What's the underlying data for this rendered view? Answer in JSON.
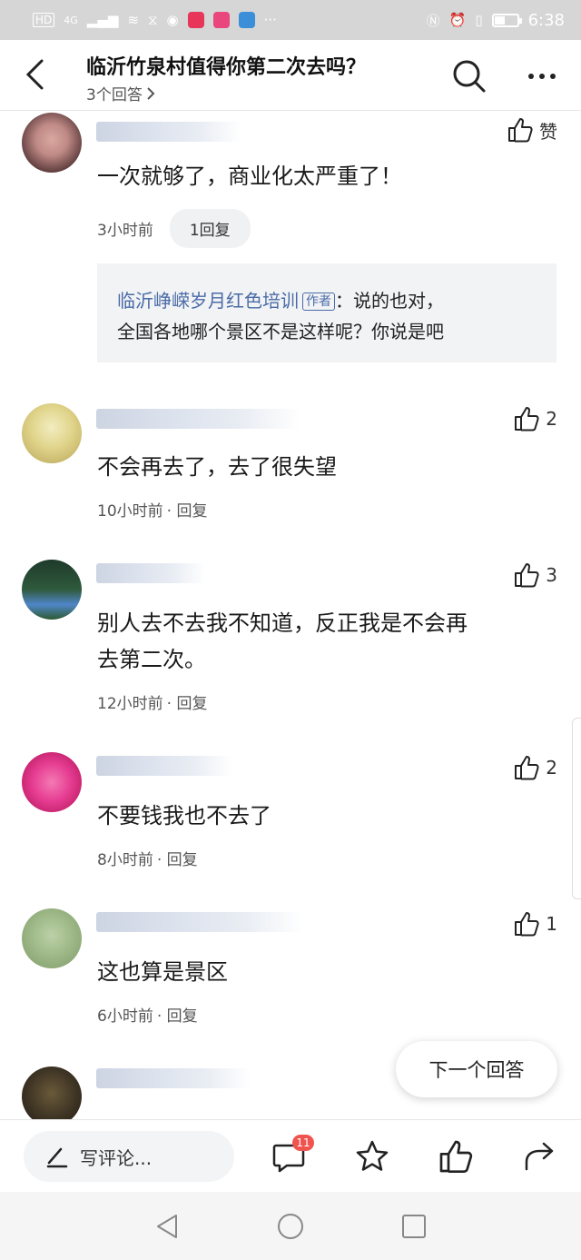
{
  "status_bar": {
    "network_label": "HD",
    "signal_label": "4G",
    "time": "6:38"
  },
  "header": {
    "title": "临沂竹泉村值得你第二次去吗？",
    "answer_count": "3个回答",
    "back_icon": "chevron-left-icon",
    "search_icon": "search-icon",
    "more_icon": "more-dots-icon"
  },
  "comments": [
    {
      "text": "一次就够了，商业化太严重了！",
      "time": "3小时前",
      "reply_label": "1回复",
      "like_label": "赞",
      "reply_quote": {
        "author": "临沂峥嵘岁月红色培训",
        "author_tag": "作者",
        "text_line1": "：说的也对，",
        "text_line2": "全国各地哪个景区不是这样呢？你说是吧"
      }
    },
    {
      "text": "不会再去了，去了很失望",
      "time": "10小时前",
      "reply_label": "· 回复",
      "likes": "2"
    },
    {
      "text_line1": "别人去不去我不知道，反正我是不会再",
      "text_line2": "去第二次。",
      "time": "12小时前",
      "reply_label": "· 回复",
      "likes": "3"
    },
    {
      "text": "不要钱我也不去了",
      "time": "8小时前",
      "reply_label": "· 回复",
      "likes": "2"
    },
    {
      "text": "这也算是景区",
      "time": "6小时前",
      "reply_label": "· 回复",
      "likes": "1"
    }
  ],
  "next_answer_label": "下一个回答",
  "bottom_bar": {
    "write_placeholder": "写评论...",
    "comment_badge": "11"
  },
  "colors": {
    "accent_link": "#4a6ba8",
    "badge": "#f0544f"
  }
}
